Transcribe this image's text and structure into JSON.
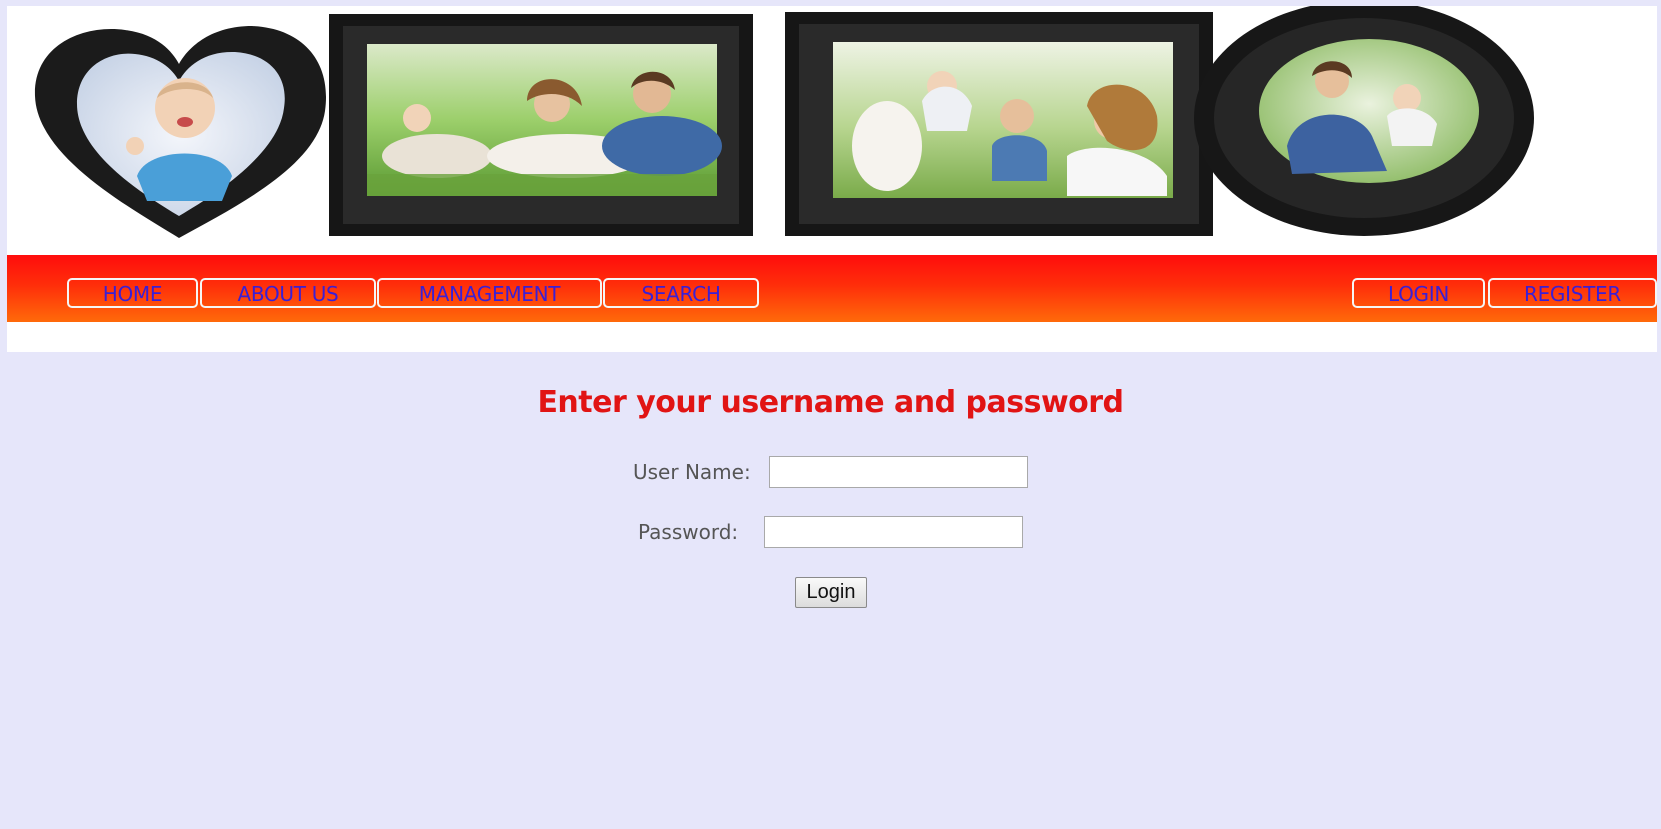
{
  "banner": {
    "photos": [
      "baby-heart-frame-photo",
      "family-rectangle-frame-photo-1",
      "family-rectangle-frame-photo-2",
      "father-child-oval-frame-photo"
    ]
  },
  "nav": {
    "left_items": [
      {
        "label": "HOME"
      },
      {
        "label": "ABOUT US"
      },
      {
        "label": "MANAGEMENT"
      },
      {
        "label": "SEARCH"
      }
    ],
    "right_items": [
      {
        "label": "LOGIN"
      },
      {
        "label": "REGISTER"
      }
    ]
  },
  "login_form": {
    "title": "Enter your username and password",
    "username_label": "User Name:",
    "username_value": "",
    "password_label": "Password:",
    "password_value": "",
    "submit_label": "Login"
  },
  "colors": {
    "page_background": "#e6e6fa",
    "nav_gradient_top": "#ff0d0d",
    "nav_gradient_bottom": "#ff6a0a",
    "nav_text": "#3a1fd6",
    "title_text": "#e11414"
  }
}
